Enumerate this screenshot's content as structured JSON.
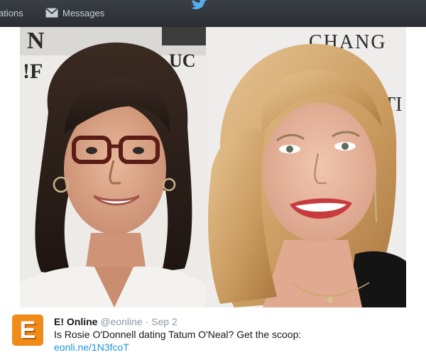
{
  "topbar": {
    "notifications_label": "ations",
    "messages_label": "Messages"
  },
  "photo": {
    "left_backdrop_lines": [
      "N",
      "!F",
      "UC"
    ],
    "right_backdrop_lines": [
      "CHANG",
      "TI"
    ]
  },
  "tweet": {
    "avatar_glyph": "E",
    "name": "E! Online",
    "handle": "@eonline",
    "separator": "·",
    "date": "Sep 2",
    "text": "Is Rosie O'Donnell dating Tatum O'Neal? Get the scoop:",
    "link": "eonli.ne/1N3fcoT"
  },
  "colors": {
    "avatar_bg": "#f08a19",
    "link": "#1b95e0",
    "topbar": "#2f3337"
  }
}
